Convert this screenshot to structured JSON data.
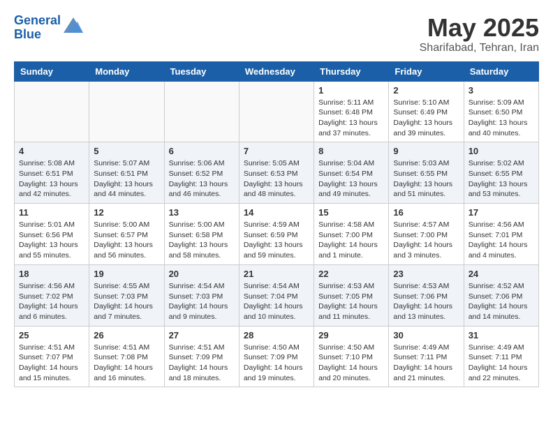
{
  "header": {
    "logo_line1": "General",
    "logo_line2": "Blue",
    "month_title": "May 2025",
    "location": "Sharifabad, Tehran, Iran"
  },
  "weekdays": [
    "Sunday",
    "Monday",
    "Tuesday",
    "Wednesday",
    "Thursday",
    "Friday",
    "Saturday"
  ],
  "weeks": [
    [
      {
        "day": "",
        "info": ""
      },
      {
        "day": "",
        "info": ""
      },
      {
        "day": "",
        "info": ""
      },
      {
        "day": "",
        "info": ""
      },
      {
        "day": "1",
        "info": "Sunrise: 5:11 AM\nSunset: 6:48 PM\nDaylight: 13 hours\nand 37 minutes."
      },
      {
        "day": "2",
        "info": "Sunrise: 5:10 AM\nSunset: 6:49 PM\nDaylight: 13 hours\nand 39 minutes."
      },
      {
        "day": "3",
        "info": "Sunrise: 5:09 AM\nSunset: 6:50 PM\nDaylight: 13 hours\nand 40 minutes."
      }
    ],
    [
      {
        "day": "4",
        "info": "Sunrise: 5:08 AM\nSunset: 6:51 PM\nDaylight: 13 hours\nand 42 minutes."
      },
      {
        "day": "5",
        "info": "Sunrise: 5:07 AM\nSunset: 6:51 PM\nDaylight: 13 hours\nand 44 minutes."
      },
      {
        "day": "6",
        "info": "Sunrise: 5:06 AM\nSunset: 6:52 PM\nDaylight: 13 hours\nand 46 minutes."
      },
      {
        "day": "7",
        "info": "Sunrise: 5:05 AM\nSunset: 6:53 PM\nDaylight: 13 hours\nand 48 minutes."
      },
      {
        "day": "8",
        "info": "Sunrise: 5:04 AM\nSunset: 6:54 PM\nDaylight: 13 hours\nand 49 minutes."
      },
      {
        "day": "9",
        "info": "Sunrise: 5:03 AM\nSunset: 6:55 PM\nDaylight: 13 hours\nand 51 minutes."
      },
      {
        "day": "10",
        "info": "Sunrise: 5:02 AM\nSunset: 6:55 PM\nDaylight: 13 hours\nand 53 minutes."
      }
    ],
    [
      {
        "day": "11",
        "info": "Sunrise: 5:01 AM\nSunset: 6:56 PM\nDaylight: 13 hours\nand 55 minutes."
      },
      {
        "day": "12",
        "info": "Sunrise: 5:00 AM\nSunset: 6:57 PM\nDaylight: 13 hours\nand 56 minutes."
      },
      {
        "day": "13",
        "info": "Sunrise: 5:00 AM\nSunset: 6:58 PM\nDaylight: 13 hours\nand 58 minutes."
      },
      {
        "day": "14",
        "info": "Sunrise: 4:59 AM\nSunset: 6:59 PM\nDaylight: 13 hours\nand 59 minutes."
      },
      {
        "day": "15",
        "info": "Sunrise: 4:58 AM\nSunset: 7:00 PM\nDaylight: 14 hours\nand 1 minute."
      },
      {
        "day": "16",
        "info": "Sunrise: 4:57 AM\nSunset: 7:00 PM\nDaylight: 14 hours\nand 3 minutes."
      },
      {
        "day": "17",
        "info": "Sunrise: 4:56 AM\nSunset: 7:01 PM\nDaylight: 14 hours\nand 4 minutes."
      }
    ],
    [
      {
        "day": "18",
        "info": "Sunrise: 4:56 AM\nSunset: 7:02 PM\nDaylight: 14 hours\nand 6 minutes."
      },
      {
        "day": "19",
        "info": "Sunrise: 4:55 AM\nSunset: 7:03 PM\nDaylight: 14 hours\nand 7 minutes."
      },
      {
        "day": "20",
        "info": "Sunrise: 4:54 AM\nSunset: 7:03 PM\nDaylight: 14 hours\nand 9 minutes."
      },
      {
        "day": "21",
        "info": "Sunrise: 4:54 AM\nSunset: 7:04 PM\nDaylight: 14 hours\nand 10 minutes."
      },
      {
        "day": "22",
        "info": "Sunrise: 4:53 AM\nSunset: 7:05 PM\nDaylight: 14 hours\nand 11 minutes."
      },
      {
        "day": "23",
        "info": "Sunrise: 4:53 AM\nSunset: 7:06 PM\nDaylight: 14 hours\nand 13 minutes."
      },
      {
        "day": "24",
        "info": "Sunrise: 4:52 AM\nSunset: 7:06 PM\nDaylight: 14 hours\nand 14 minutes."
      }
    ],
    [
      {
        "day": "25",
        "info": "Sunrise: 4:51 AM\nSunset: 7:07 PM\nDaylight: 14 hours\nand 15 minutes."
      },
      {
        "day": "26",
        "info": "Sunrise: 4:51 AM\nSunset: 7:08 PM\nDaylight: 14 hours\nand 16 minutes."
      },
      {
        "day": "27",
        "info": "Sunrise: 4:51 AM\nSunset: 7:09 PM\nDaylight: 14 hours\nand 18 minutes."
      },
      {
        "day": "28",
        "info": "Sunrise: 4:50 AM\nSunset: 7:09 PM\nDaylight: 14 hours\nand 19 minutes."
      },
      {
        "day": "29",
        "info": "Sunrise: 4:50 AM\nSunset: 7:10 PM\nDaylight: 14 hours\nand 20 minutes."
      },
      {
        "day": "30",
        "info": "Sunrise: 4:49 AM\nSunset: 7:11 PM\nDaylight: 14 hours\nand 21 minutes."
      },
      {
        "day": "31",
        "info": "Sunrise: 4:49 AM\nSunset: 7:11 PM\nDaylight: 14 hours\nand 22 minutes."
      }
    ]
  ]
}
